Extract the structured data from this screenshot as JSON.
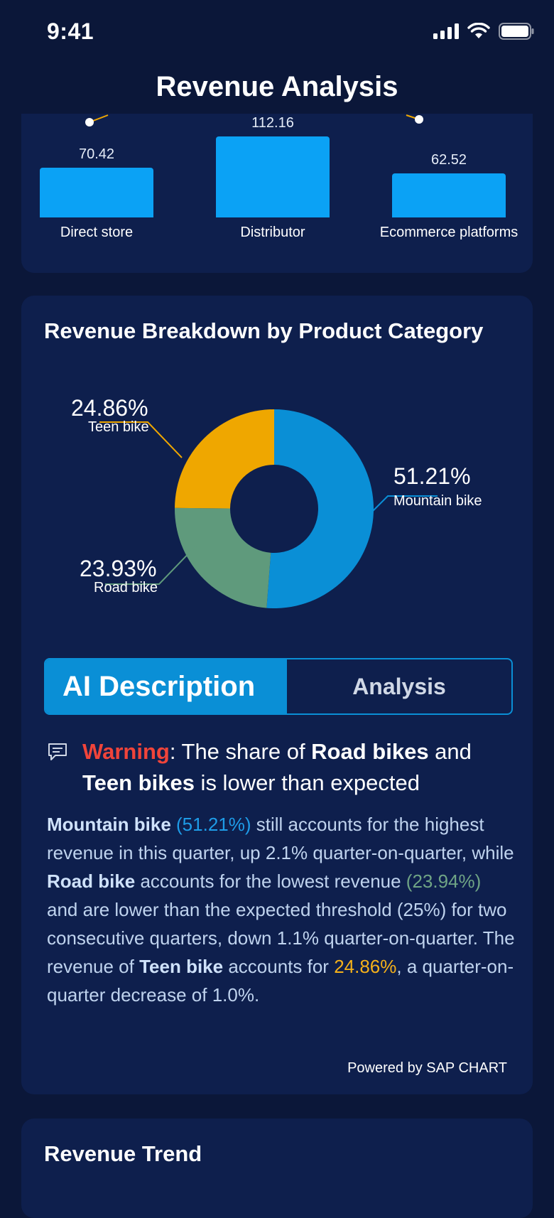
{
  "status": {
    "time": "9:41"
  },
  "nav": {
    "title": "Revenue Analysis"
  },
  "bars": {
    "items": [
      {
        "label": "Direct store",
        "value": "70.42"
      },
      {
        "label": "Distributor",
        "value": "112.16"
      },
      {
        "label": "Ecommerce platforms",
        "value": "62.52"
      }
    ]
  },
  "donut_card": {
    "title": "Revenue Breakdown by Product Category",
    "slices": [
      {
        "pct": "51.21%",
        "name": "Mountain bike",
        "color": "#0a8fd6"
      },
      {
        "pct": "23.93%",
        "name": "Road bike",
        "color": "#5f9a7c"
      },
      {
        "pct": "24.86%",
        "name": "Teen bike",
        "color": "#efa700"
      }
    ],
    "tabs": {
      "active": "AI Description",
      "inactive": "Analysis"
    },
    "warning": {
      "label": "Warning",
      "t1": ": The share of ",
      "b1": "Road bikes",
      "t2": " and ",
      "b2": "Teen bikes",
      "t3": " is lower than expected"
    },
    "description": {
      "b_mountain": "Mountain bike",
      "p_mountain": "(51.21%)",
      "s1": " still accounts for the highest revenue in this quarter, up 2.1% quarter-on-quarter, while ",
      "b_road": "Road bike",
      "s2": " accounts for the lowest revenue ",
      "p_road": "(23.94%)",
      "s3": " and are lower than the expected threshold (25%) for two consecutive quarters, down 1.1% quarter-on-quarter. The revenue of ",
      "b_teen": "Teen bike",
      "s4": " accounts for ",
      "p_teen": "24.86%",
      "s5": ", a quarter-on-quarter decrease of 1.0%."
    },
    "powered": "Powered by SAP CHART"
  },
  "trend_card": {
    "title": "Revenue Trend"
  },
  "chart_data": [
    {
      "type": "bar",
      "categories": [
        "Direct store",
        "Distributor",
        "Ecommerce platforms"
      ],
      "values": [
        70.42,
        112.16,
        62.52
      ]
    },
    {
      "type": "pie",
      "title": "Revenue Breakdown by Product Category",
      "categories": [
        "Mountain bike",
        "Road bike",
        "Teen bike"
      ],
      "values": [
        51.21,
        23.93,
        24.86
      ]
    }
  ]
}
